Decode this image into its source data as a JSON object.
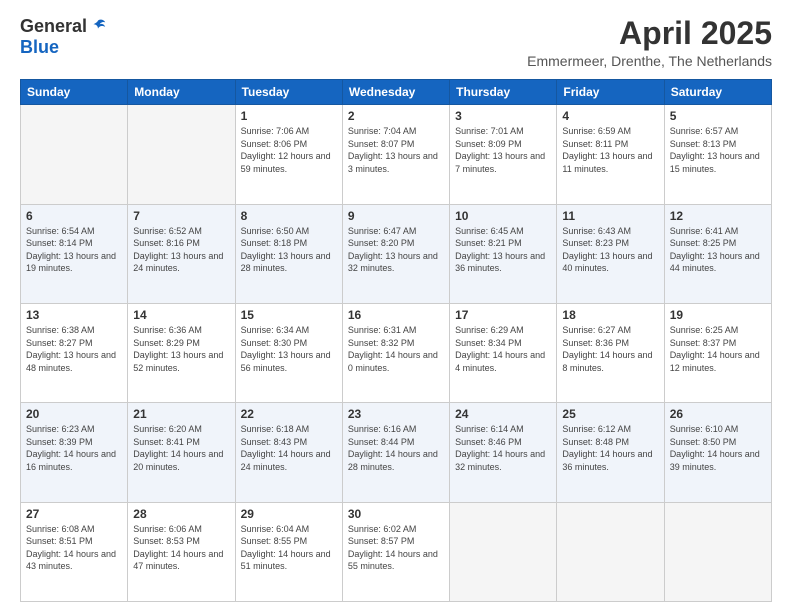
{
  "header": {
    "logo": {
      "line1": "General",
      "line2": "Blue"
    },
    "title": "April 2025",
    "subtitle": "Emmermeer, Drenthe, The Netherlands"
  },
  "weekdays": [
    "Sunday",
    "Monday",
    "Tuesday",
    "Wednesday",
    "Thursday",
    "Friday",
    "Saturday"
  ],
  "weeks": [
    [
      {
        "day": "",
        "info": ""
      },
      {
        "day": "",
        "info": ""
      },
      {
        "day": "1",
        "info": "Sunrise: 7:06 AM\nSunset: 8:06 PM\nDaylight: 12 hours\nand 59 minutes."
      },
      {
        "day": "2",
        "info": "Sunrise: 7:04 AM\nSunset: 8:07 PM\nDaylight: 13 hours\nand 3 minutes."
      },
      {
        "day": "3",
        "info": "Sunrise: 7:01 AM\nSunset: 8:09 PM\nDaylight: 13 hours\nand 7 minutes."
      },
      {
        "day": "4",
        "info": "Sunrise: 6:59 AM\nSunset: 8:11 PM\nDaylight: 13 hours\nand 11 minutes."
      },
      {
        "day": "5",
        "info": "Sunrise: 6:57 AM\nSunset: 8:13 PM\nDaylight: 13 hours\nand 15 minutes."
      }
    ],
    [
      {
        "day": "6",
        "info": "Sunrise: 6:54 AM\nSunset: 8:14 PM\nDaylight: 13 hours\nand 19 minutes."
      },
      {
        "day": "7",
        "info": "Sunrise: 6:52 AM\nSunset: 8:16 PM\nDaylight: 13 hours\nand 24 minutes."
      },
      {
        "day": "8",
        "info": "Sunrise: 6:50 AM\nSunset: 8:18 PM\nDaylight: 13 hours\nand 28 minutes."
      },
      {
        "day": "9",
        "info": "Sunrise: 6:47 AM\nSunset: 8:20 PM\nDaylight: 13 hours\nand 32 minutes."
      },
      {
        "day": "10",
        "info": "Sunrise: 6:45 AM\nSunset: 8:21 PM\nDaylight: 13 hours\nand 36 minutes."
      },
      {
        "day": "11",
        "info": "Sunrise: 6:43 AM\nSunset: 8:23 PM\nDaylight: 13 hours\nand 40 minutes."
      },
      {
        "day": "12",
        "info": "Sunrise: 6:41 AM\nSunset: 8:25 PM\nDaylight: 13 hours\nand 44 minutes."
      }
    ],
    [
      {
        "day": "13",
        "info": "Sunrise: 6:38 AM\nSunset: 8:27 PM\nDaylight: 13 hours\nand 48 minutes."
      },
      {
        "day": "14",
        "info": "Sunrise: 6:36 AM\nSunset: 8:29 PM\nDaylight: 13 hours\nand 52 minutes."
      },
      {
        "day": "15",
        "info": "Sunrise: 6:34 AM\nSunset: 8:30 PM\nDaylight: 13 hours\nand 56 minutes."
      },
      {
        "day": "16",
        "info": "Sunrise: 6:31 AM\nSunset: 8:32 PM\nDaylight: 14 hours\nand 0 minutes."
      },
      {
        "day": "17",
        "info": "Sunrise: 6:29 AM\nSunset: 8:34 PM\nDaylight: 14 hours\nand 4 minutes."
      },
      {
        "day": "18",
        "info": "Sunrise: 6:27 AM\nSunset: 8:36 PM\nDaylight: 14 hours\nand 8 minutes."
      },
      {
        "day": "19",
        "info": "Sunrise: 6:25 AM\nSunset: 8:37 PM\nDaylight: 14 hours\nand 12 minutes."
      }
    ],
    [
      {
        "day": "20",
        "info": "Sunrise: 6:23 AM\nSunset: 8:39 PM\nDaylight: 14 hours\nand 16 minutes."
      },
      {
        "day": "21",
        "info": "Sunrise: 6:20 AM\nSunset: 8:41 PM\nDaylight: 14 hours\nand 20 minutes."
      },
      {
        "day": "22",
        "info": "Sunrise: 6:18 AM\nSunset: 8:43 PM\nDaylight: 14 hours\nand 24 minutes."
      },
      {
        "day": "23",
        "info": "Sunrise: 6:16 AM\nSunset: 8:44 PM\nDaylight: 14 hours\nand 28 minutes."
      },
      {
        "day": "24",
        "info": "Sunrise: 6:14 AM\nSunset: 8:46 PM\nDaylight: 14 hours\nand 32 minutes."
      },
      {
        "day": "25",
        "info": "Sunrise: 6:12 AM\nSunset: 8:48 PM\nDaylight: 14 hours\nand 36 minutes."
      },
      {
        "day": "26",
        "info": "Sunrise: 6:10 AM\nSunset: 8:50 PM\nDaylight: 14 hours\nand 39 minutes."
      }
    ],
    [
      {
        "day": "27",
        "info": "Sunrise: 6:08 AM\nSunset: 8:51 PM\nDaylight: 14 hours\nand 43 minutes."
      },
      {
        "day": "28",
        "info": "Sunrise: 6:06 AM\nSunset: 8:53 PM\nDaylight: 14 hours\nand 47 minutes."
      },
      {
        "day": "29",
        "info": "Sunrise: 6:04 AM\nSunset: 8:55 PM\nDaylight: 14 hours\nand 51 minutes."
      },
      {
        "day": "30",
        "info": "Sunrise: 6:02 AM\nSunset: 8:57 PM\nDaylight: 14 hours\nand 55 minutes."
      },
      {
        "day": "",
        "info": ""
      },
      {
        "day": "",
        "info": ""
      },
      {
        "day": "",
        "info": ""
      }
    ]
  ]
}
